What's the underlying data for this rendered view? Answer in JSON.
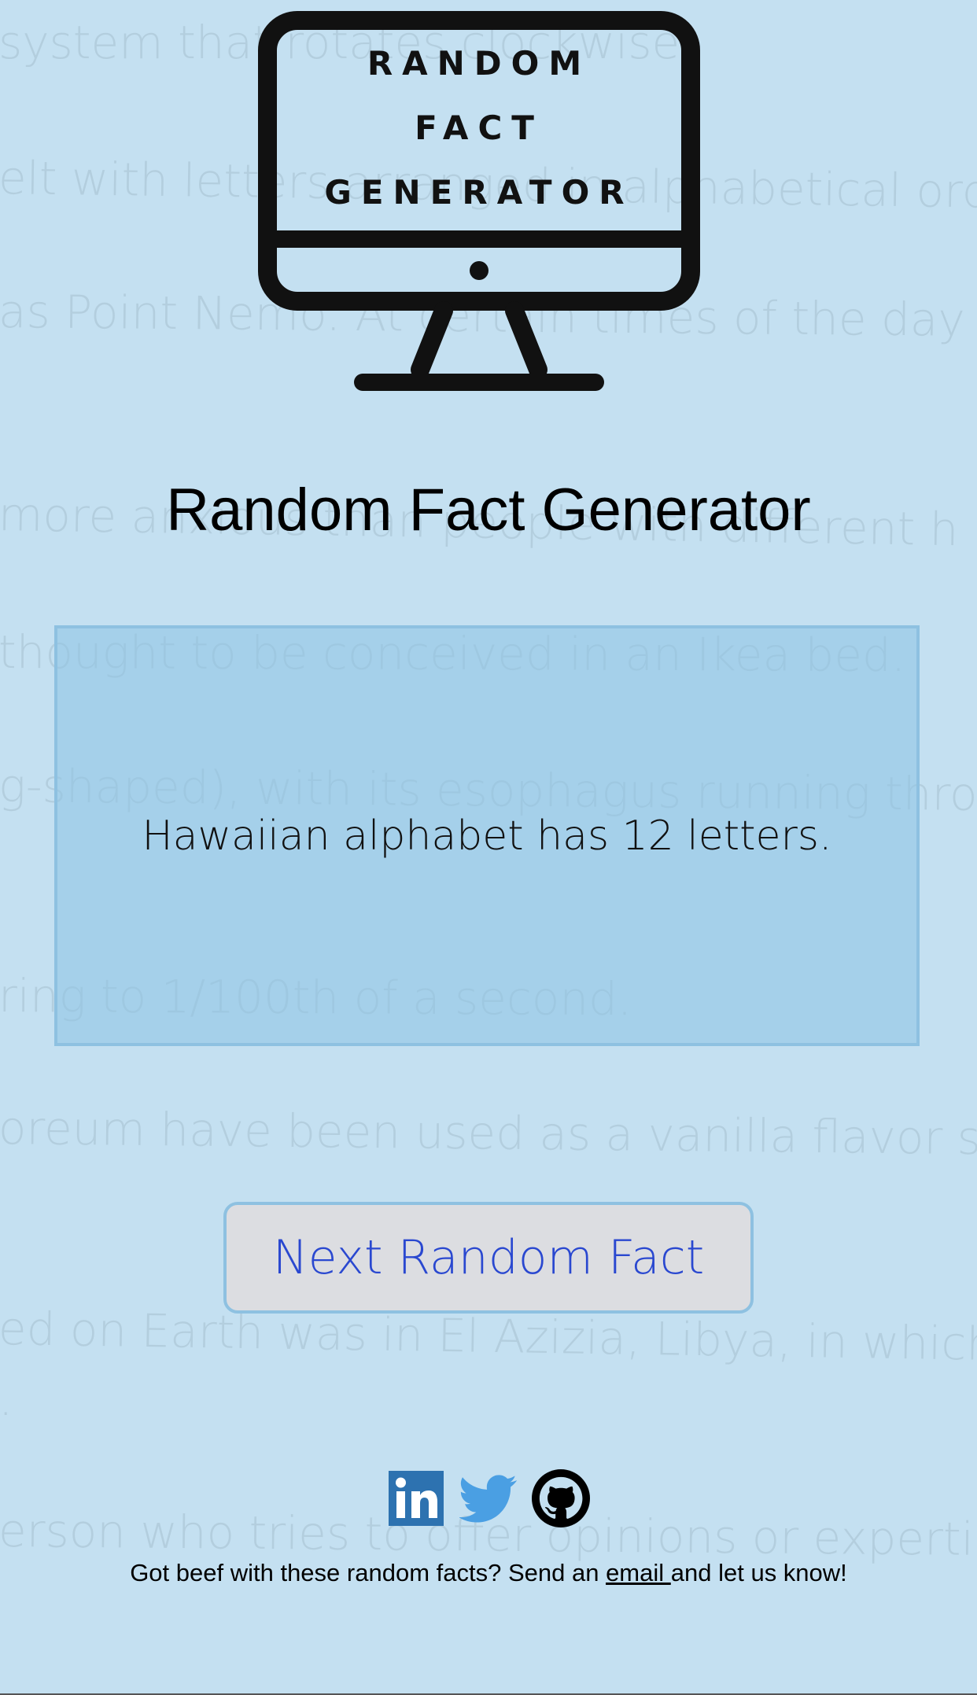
{
  "background_lines": [
    "system that rotates clockwise.",
    "elt with letters arranged in alphabetical orde",
    "as Point Nemo. At certain times of the day it's",
    "more anxious than people with different h",
    "thought to be conceived in an Ikea bed.",
    "g-shaped), with its esophagus running throug",
    "ring to 1/100th of a second.",
    "oreum have been used as a vanilla flavor sub",
    "ed on Earth was in El Azizia, Libya, in which a",
    ".",
    "erson who tries to offer opinions or expertise"
  ],
  "logo": {
    "line1": "RANDOM",
    "line2": "FACT",
    "line3": "GENERATOR"
  },
  "title": "Random Fact Generator",
  "fact": "Hawaiian alphabet has 12 letters.",
  "button_label": "Next Random Fact",
  "social": {
    "linkedin_icon": "linkedin-icon",
    "twitter_icon": "twitter-icon",
    "github_icon": "github-icon",
    "linkedin_color": "#2d72b0",
    "twitter_color": "#4a9fe3",
    "github_color": "#000000"
  },
  "footer": {
    "before": "Got beef with these random facts? Send an ",
    "link": "email ",
    "after": "and let us know!"
  },
  "colors": {
    "background": "#c4e0f1",
    "fact_box": "#a6d1ea",
    "border": "#8ec1e1",
    "button_bg": "#dcdde1",
    "button_text": "#2a48d0"
  }
}
